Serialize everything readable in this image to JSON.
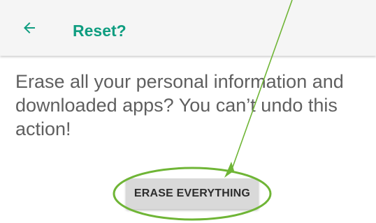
{
  "app_bar": {
    "back_icon": "arrow-left-icon",
    "title": "Reset?"
  },
  "message": {
    "text": "Erase all your personal information and downloaded apps? You can’t undo this action!"
  },
  "actions": {
    "erase_label": "ERASE EVERYTHING"
  },
  "colors": {
    "accent": "#0f9d80",
    "app_bar_bg": "#f5f5f5",
    "body_text": "#5f5f5f",
    "button_bg": "#d9d9d9",
    "annotation": "#6fb536"
  }
}
